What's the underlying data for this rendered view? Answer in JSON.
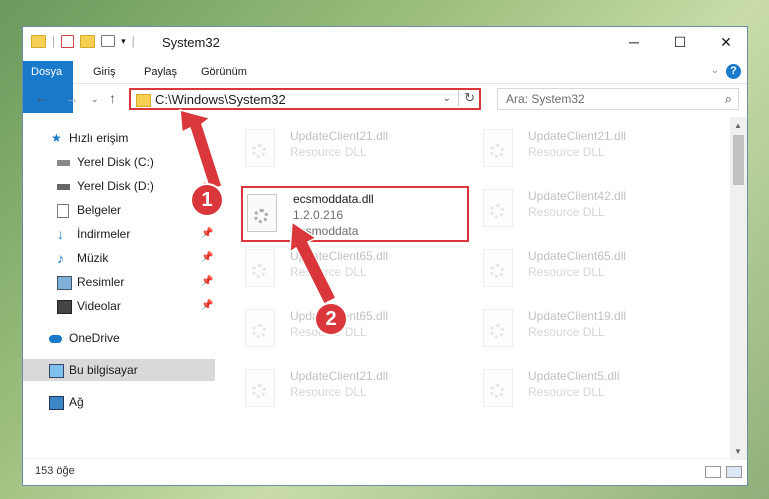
{
  "window": {
    "title": "System32"
  },
  "ribbon": {
    "tabs": [
      "Dosya",
      "Giriş",
      "Paylaş",
      "Görünüm"
    ],
    "help": "?"
  },
  "nav": {
    "path": "C:\\Windows\\System32",
    "search_placeholder": "Ara: System32"
  },
  "sidebar": {
    "items": [
      {
        "label": "Hızlı erişim",
        "icon": "star-icon"
      },
      {
        "label": "Yerel Disk (C:)",
        "icon": "drive-icon",
        "pinned": true
      },
      {
        "label": "Yerel Disk (D:)",
        "icon": "drive-icon",
        "pinned": true
      },
      {
        "label": "Belgeler",
        "icon": "documents-icon",
        "pinned": true
      },
      {
        "label": "İndirmeler",
        "icon": "download-icon",
        "pinned": true
      },
      {
        "label": "Müzik",
        "icon": "music-icon",
        "pinned": true
      },
      {
        "label": "Resimler",
        "icon": "pictures-icon",
        "pinned": true
      },
      {
        "label": "Videolar",
        "icon": "videos-icon",
        "pinned": true
      },
      {
        "label": "OneDrive",
        "icon": "cloud-icon"
      },
      {
        "label": "Bu bilgisayar",
        "icon": "computer-icon",
        "selected": true
      },
      {
        "label": "Ağ",
        "icon": "network-icon"
      }
    ]
  },
  "files": {
    "highlighted": {
      "name": "ecsmoddata.dll",
      "version": "1.2.0.216",
      "desc": "ecsmoddata"
    },
    "background": [
      {
        "name": "UpdateClient21.dll",
        "desc": "Resource DLL"
      },
      {
        "name": "UpdateClient21.dll",
        "desc": "Resource DLL"
      },
      {
        "name": "UpdateClient42.dll",
        "desc": "Resource DLL"
      },
      {
        "name": "UpdateClient65.dll",
        "desc": "Resource DLL"
      },
      {
        "name": "UpdateClient65.dll",
        "desc": "Resource DLL"
      },
      {
        "name": "UpdateClient65.dll",
        "desc": "Resource DLL"
      },
      {
        "name": "UpdateClient19.dll",
        "desc": "Resource DLL"
      },
      {
        "name": "UpdateClient21.dll",
        "desc": "Resource DLL"
      },
      {
        "name": "UpdateClient5.dll",
        "desc": "Resource DLL"
      }
    ]
  },
  "status": {
    "count": "153 öğe"
  },
  "annotations": {
    "step1": "1",
    "step2": "2",
    "color": "#d9373b"
  }
}
